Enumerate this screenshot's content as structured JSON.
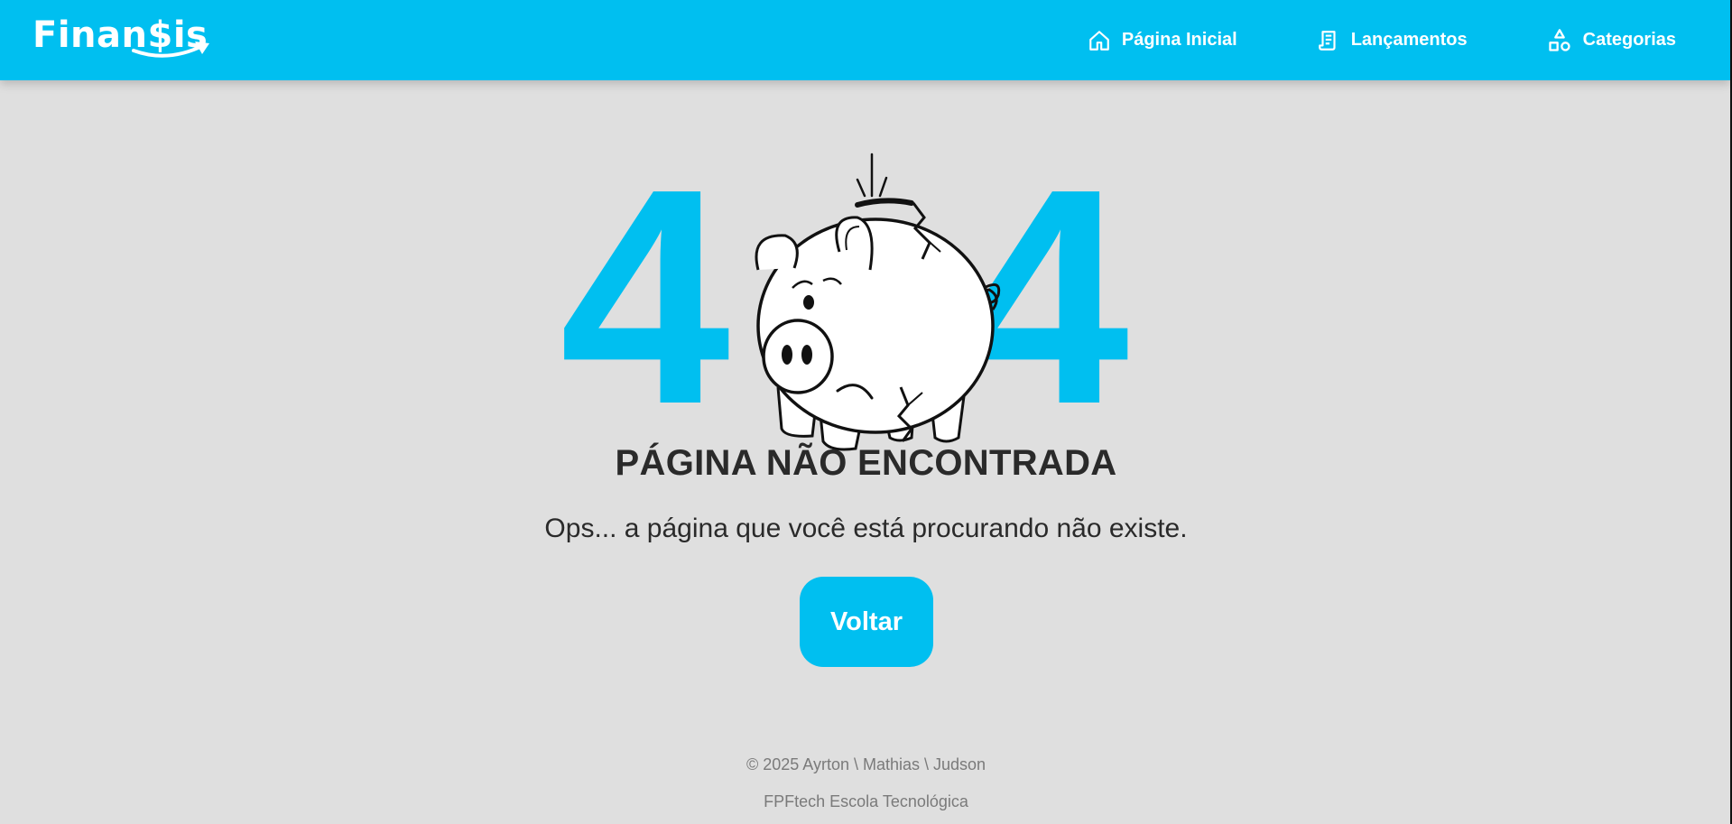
{
  "header": {
    "logo_text": "Finan$is",
    "nav": [
      {
        "label": "Página Inicial",
        "icon": "home-icon"
      },
      {
        "label": "Lançamentos",
        "icon": "receipt-icon"
      },
      {
        "label": "Categorias",
        "icon": "shapes-icon"
      }
    ]
  },
  "error": {
    "code_left": "4",
    "code_right": "4",
    "title": "PÁGINA NÃO ENCONTRADA",
    "message": "Ops... a página que você está procurando não existe.",
    "back_label": "Voltar"
  },
  "footer": {
    "copyright": "© 2025 Ayrton \\ Mathias \\ Judson",
    "school": "FPFtech Escola Tecnológica"
  },
  "colors": {
    "accent": "#00bff0",
    "background": "#dfdfdf",
    "text": "#2a2a2a",
    "muted": "#7a7a7a"
  }
}
